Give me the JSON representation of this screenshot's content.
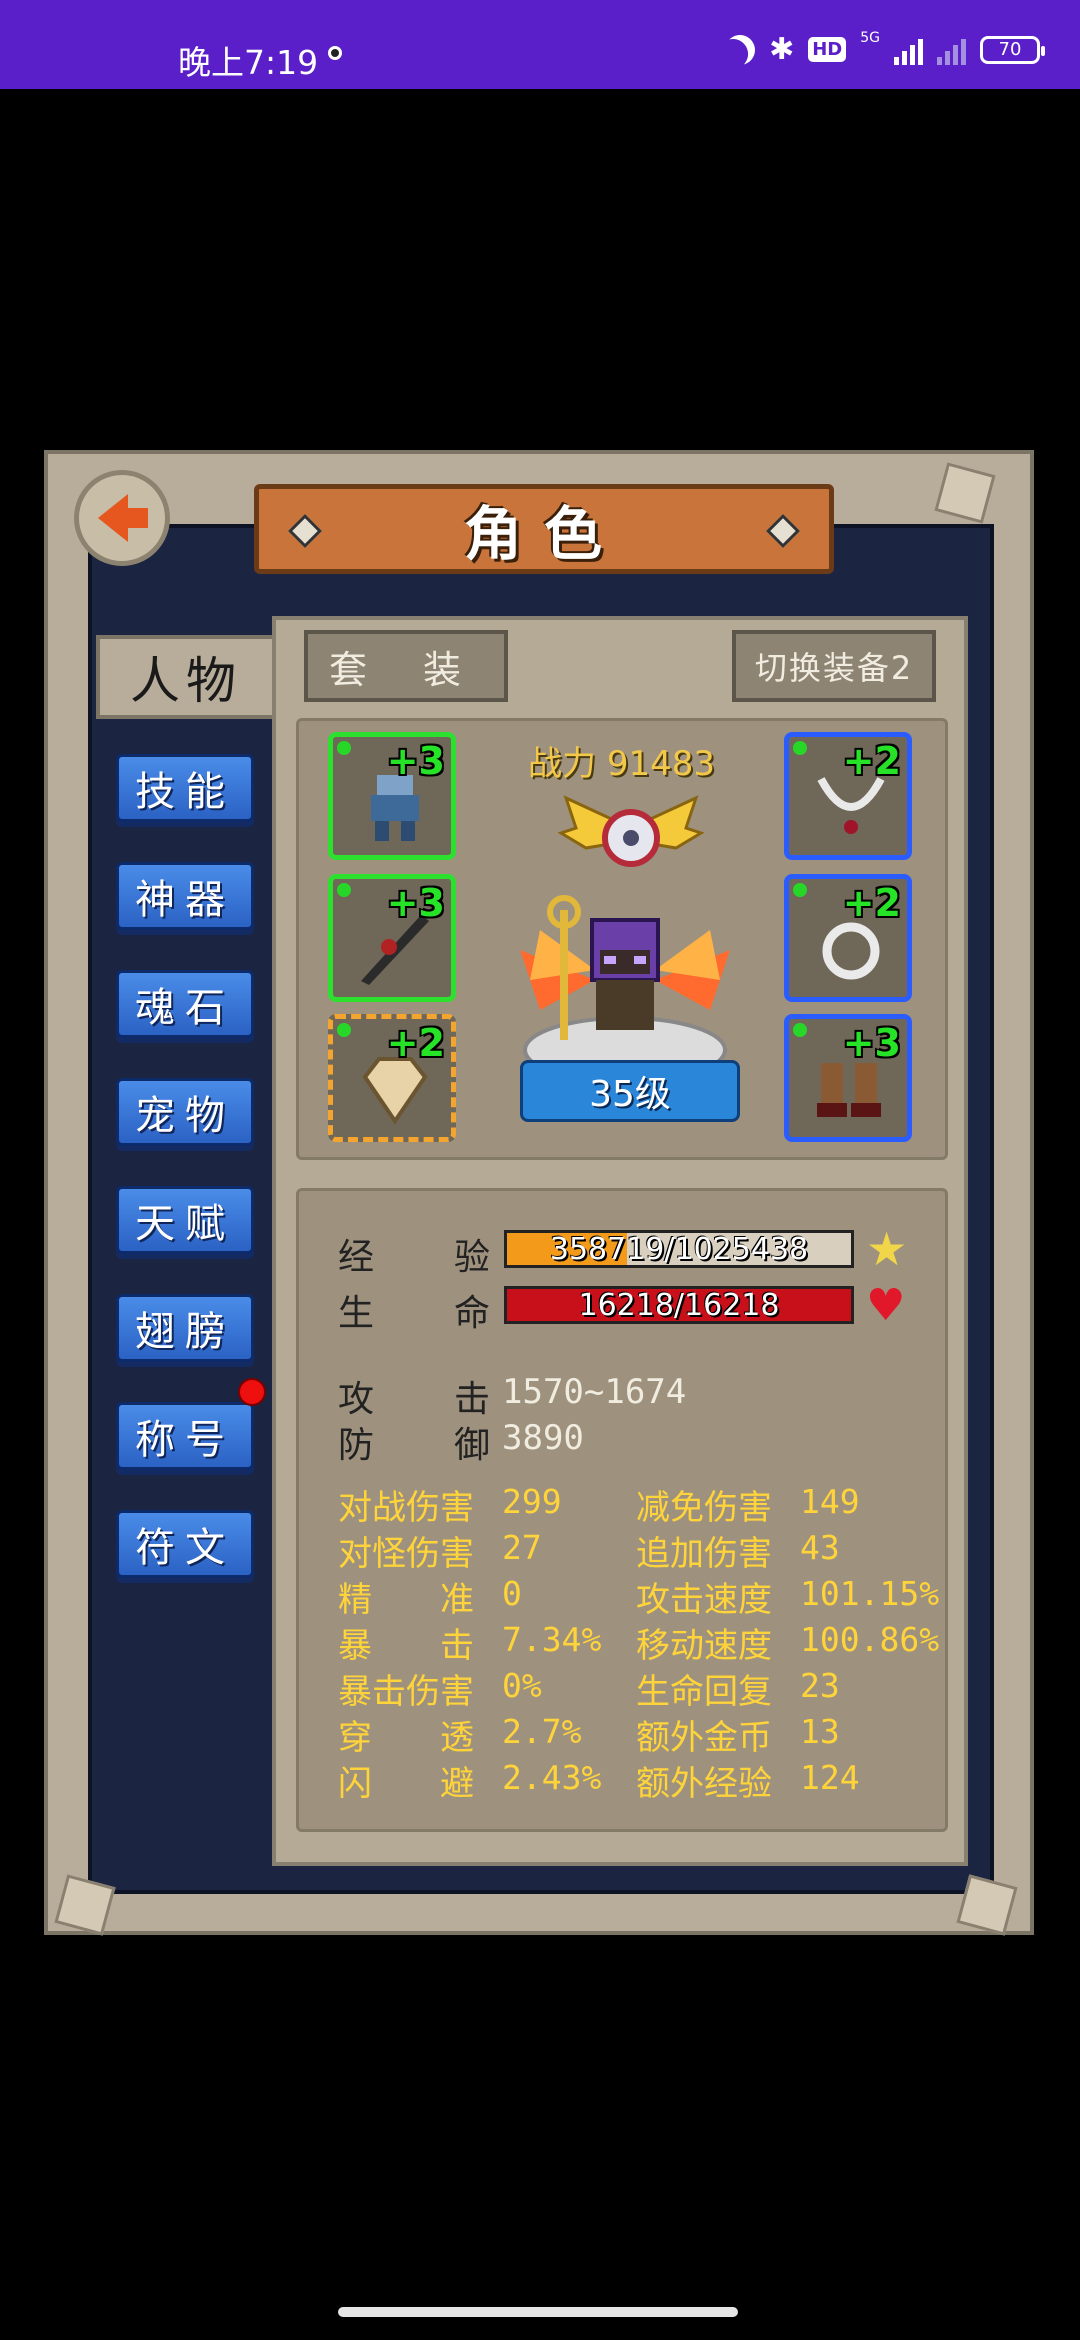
{
  "status_bar": {
    "time": "晚上7:19",
    "network": "5G",
    "hd_badge": "HD",
    "battery": "70"
  },
  "screen": {
    "title": "角色",
    "back_icon": "back-arrow-icon"
  },
  "side_tabs": {
    "active": "人物",
    "items": [
      "技能",
      "神器",
      "魂石",
      "宠物",
      "天赋",
      "翅膀",
      "称号",
      "符文"
    ],
    "notification_on": "称号"
  },
  "equipment": {
    "suit_button": "套 装",
    "switch_button": "切换装备2",
    "power_label": "战力",
    "power_value": "91483",
    "level": "35级",
    "slots_left": [
      {
        "item": "armor-icon",
        "enhance": "+3",
        "rarity_color": "#2ee02e"
      },
      {
        "item": "weapon-icon",
        "enhance": "+3",
        "rarity_color": "#2ee02e"
      },
      {
        "item": "shoulder-icon",
        "enhance": "+2",
        "rarity_color": "#f3a530"
      }
    ],
    "slots_right": [
      {
        "item": "necklace-icon",
        "enhance": "+2",
        "rarity_color": "#2a5cff"
      },
      {
        "item": "ring-icon",
        "enhance": "+2",
        "rarity_color": "#2a5cff"
      },
      {
        "item": "boots-icon",
        "enhance": "+3",
        "rarity_color": "#2a5cff"
      }
    ]
  },
  "stats": {
    "exp_label_a": "经",
    "exp_label_b": "验",
    "exp_text": "358719/1025438",
    "exp_fraction": 0.35,
    "hp_label_a": "生",
    "hp_label_b": "命",
    "hp_text": "16218/16218",
    "hp_fraction": 1.0,
    "atk_label_a": "攻",
    "atk_label_b": "击",
    "atk_value": "1570~1674",
    "def_label_a": "防",
    "def_label_b": "御",
    "def_value": "3890",
    "extra": [
      {
        "label": "对战伤害",
        "value": "299",
        "label2": "减免伤害",
        "value2": "149"
      },
      {
        "label": "对怪伤害",
        "value": "27",
        "label2": "追加伤害",
        "value2": "43"
      },
      {
        "label": "精　　准",
        "value": "0",
        "label2": "攻击速度",
        "value2": "101.15%"
      },
      {
        "label": "暴　　击",
        "value": "7.34%",
        "label2": "移动速度",
        "value2": "100.86%"
      },
      {
        "label": "暴击伤害",
        "value": "0%",
        "label2": "生命回复",
        "value2": "23"
      },
      {
        "label": "穿　　透",
        "value": "2.7%",
        "label2": "额外金币",
        "value2": "13"
      },
      {
        "label": "闪　　避",
        "value": "2.43%",
        "label2": "额外经验",
        "value2": "124"
      }
    ]
  }
}
